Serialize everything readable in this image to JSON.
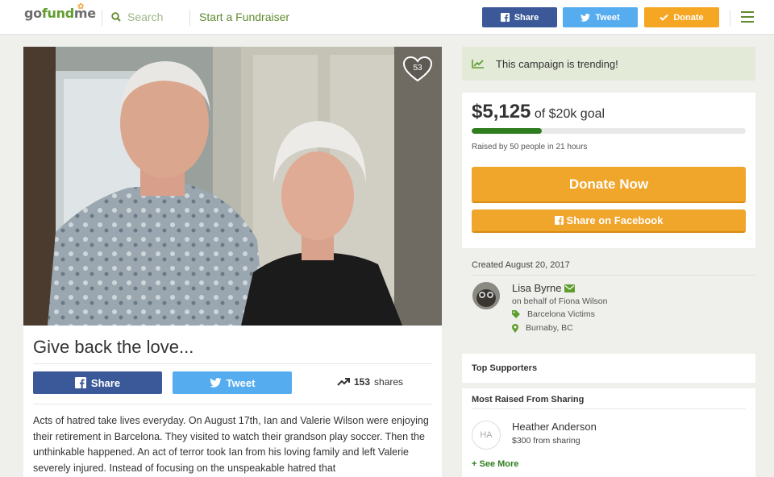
{
  "header": {
    "logo": {
      "go": "go",
      "fund": "fund",
      "me": "me"
    },
    "search_placeholder": "Search",
    "start_fundraiser": "Start a Fundraiser",
    "share_label": "Share",
    "tweet_label": "Tweet",
    "donate_label": "Donate"
  },
  "hero": {
    "heart_count": "53"
  },
  "campaign": {
    "title": "Give back the love...",
    "share_label": "Share",
    "tweet_label": "Tweet",
    "shares_count": "153",
    "shares_suffix": "shares",
    "story": "Acts of hatred take lives everyday. On August 17th, Ian and Valerie Wilson were enjoying their retirement in Barcelona. They visited to watch their grandson play soccer. Then the unthinkable happened. An act of terror took Ian from his loving family and left Valerie severely injured. Instead of focusing on the unspeakable hatred that"
  },
  "sidebar": {
    "trending_text": "This campaign is trending!",
    "amount_raised": "$5,125",
    "goal_text": "of $20k goal",
    "progress_fraction": 0.256,
    "raised_by": "Raised by 50 people in 21 hours",
    "donate_now": "Donate Now",
    "share_facebook": "Share on Facebook",
    "created": "Created August 20, 2017",
    "organizer_name": "Lisa Byrne",
    "on_behalf": "on behalf of Fiona Wilson",
    "category": "Barcelona Victims",
    "location": "Burnaby, BC",
    "top_supporters": "Top Supporters",
    "most_raised_header": "Most Raised From Sharing",
    "supporter_initials": "HA",
    "supporter_name": "Heather Anderson",
    "supporter_amount": "$300 from sharing",
    "see_more": "See More"
  },
  "colors": {
    "brand_green": "#5f9e2e",
    "facebook": "#3b5998",
    "twitter": "#55acee",
    "donate_orange": "#f0a52b",
    "progress_green": "#2f7d1f",
    "trending_bg": "#e4ead8"
  }
}
